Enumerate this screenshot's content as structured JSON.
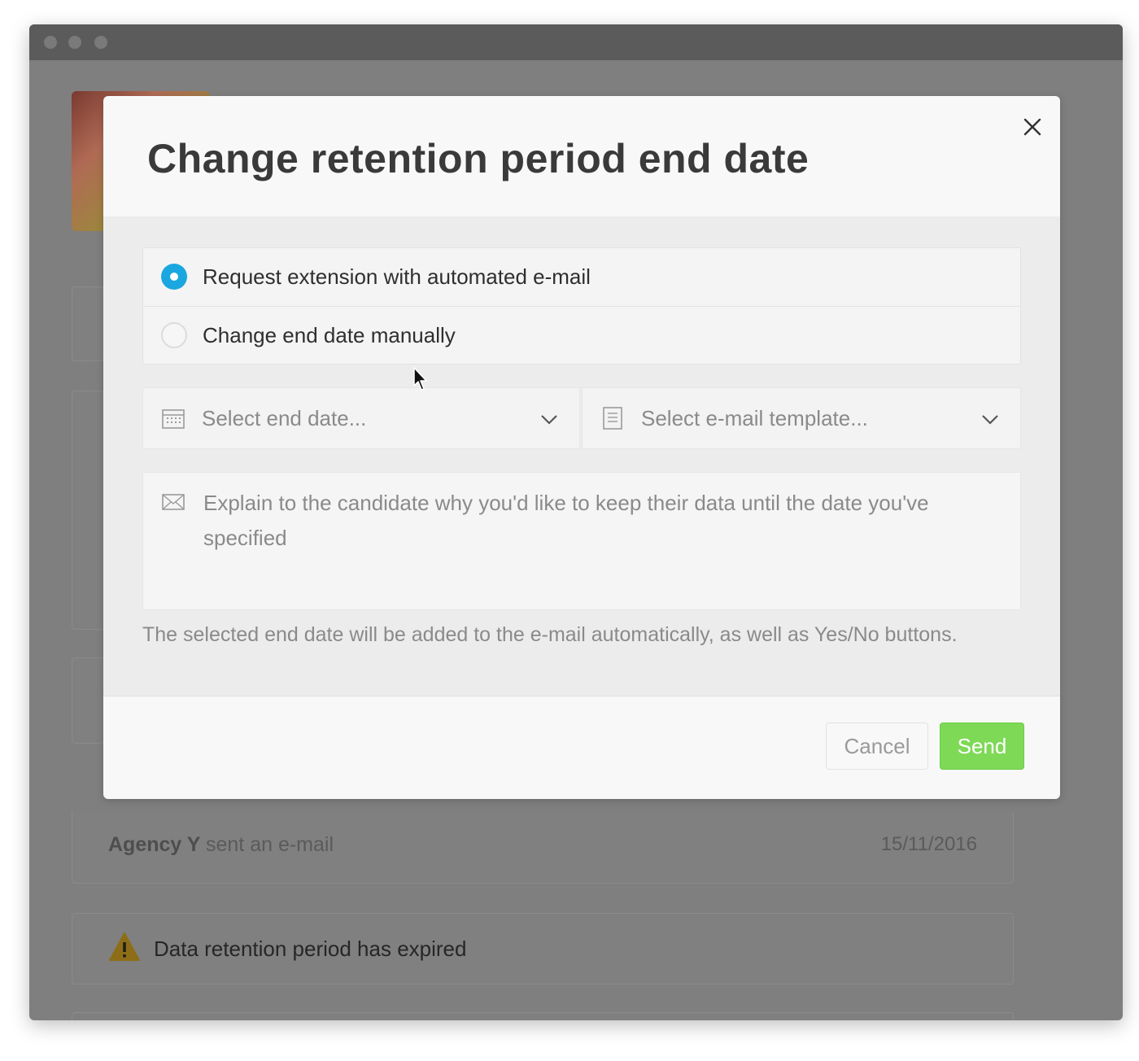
{
  "window": {
    "chrome_color": "#5b5b5b",
    "overlay_color": "#7f7f7f"
  },
  "background": {
    "email_row": {
      "sender": "Agency Y",
      "action": "sent an e-mail",
      "date": "15/11/2016"
    },
    "alert_row": {
      "icon": "warning-icon",
      "text": "Data retention period has expired"
    }
  },
  "modal": {
    "title": "Change retention period end date",
    "close_icon": "close-icon",
    "options": [
      {
        "label": "Request extension with automated e-mail",
        "selected": true
      },
      {
        "label": "Change end date manually",
        "selected": false
      }
    ],
    "end_date_select": {
      "icon": "calendar-icon",
      "placeholder": "Select end date..."
    },
    "template_select": {
      "icon": "document-icon",
      "placeholder": "Select e-mail template..."
    },
    "message": {
      "icon": "envelope-icon",
      "placeholder": "Explain to the candidate why you'd like to keep their data until the date you've specified"
    },
    "hint": "The selected end date will be added to the e-mail automatically, as well as Yes/No buttons.",
    "cancel_label": "Cancel",
    "send_label": "Send",
    "accent_color": "#1aa7e0",
    "send_color": "#7ed957"
  }
}
